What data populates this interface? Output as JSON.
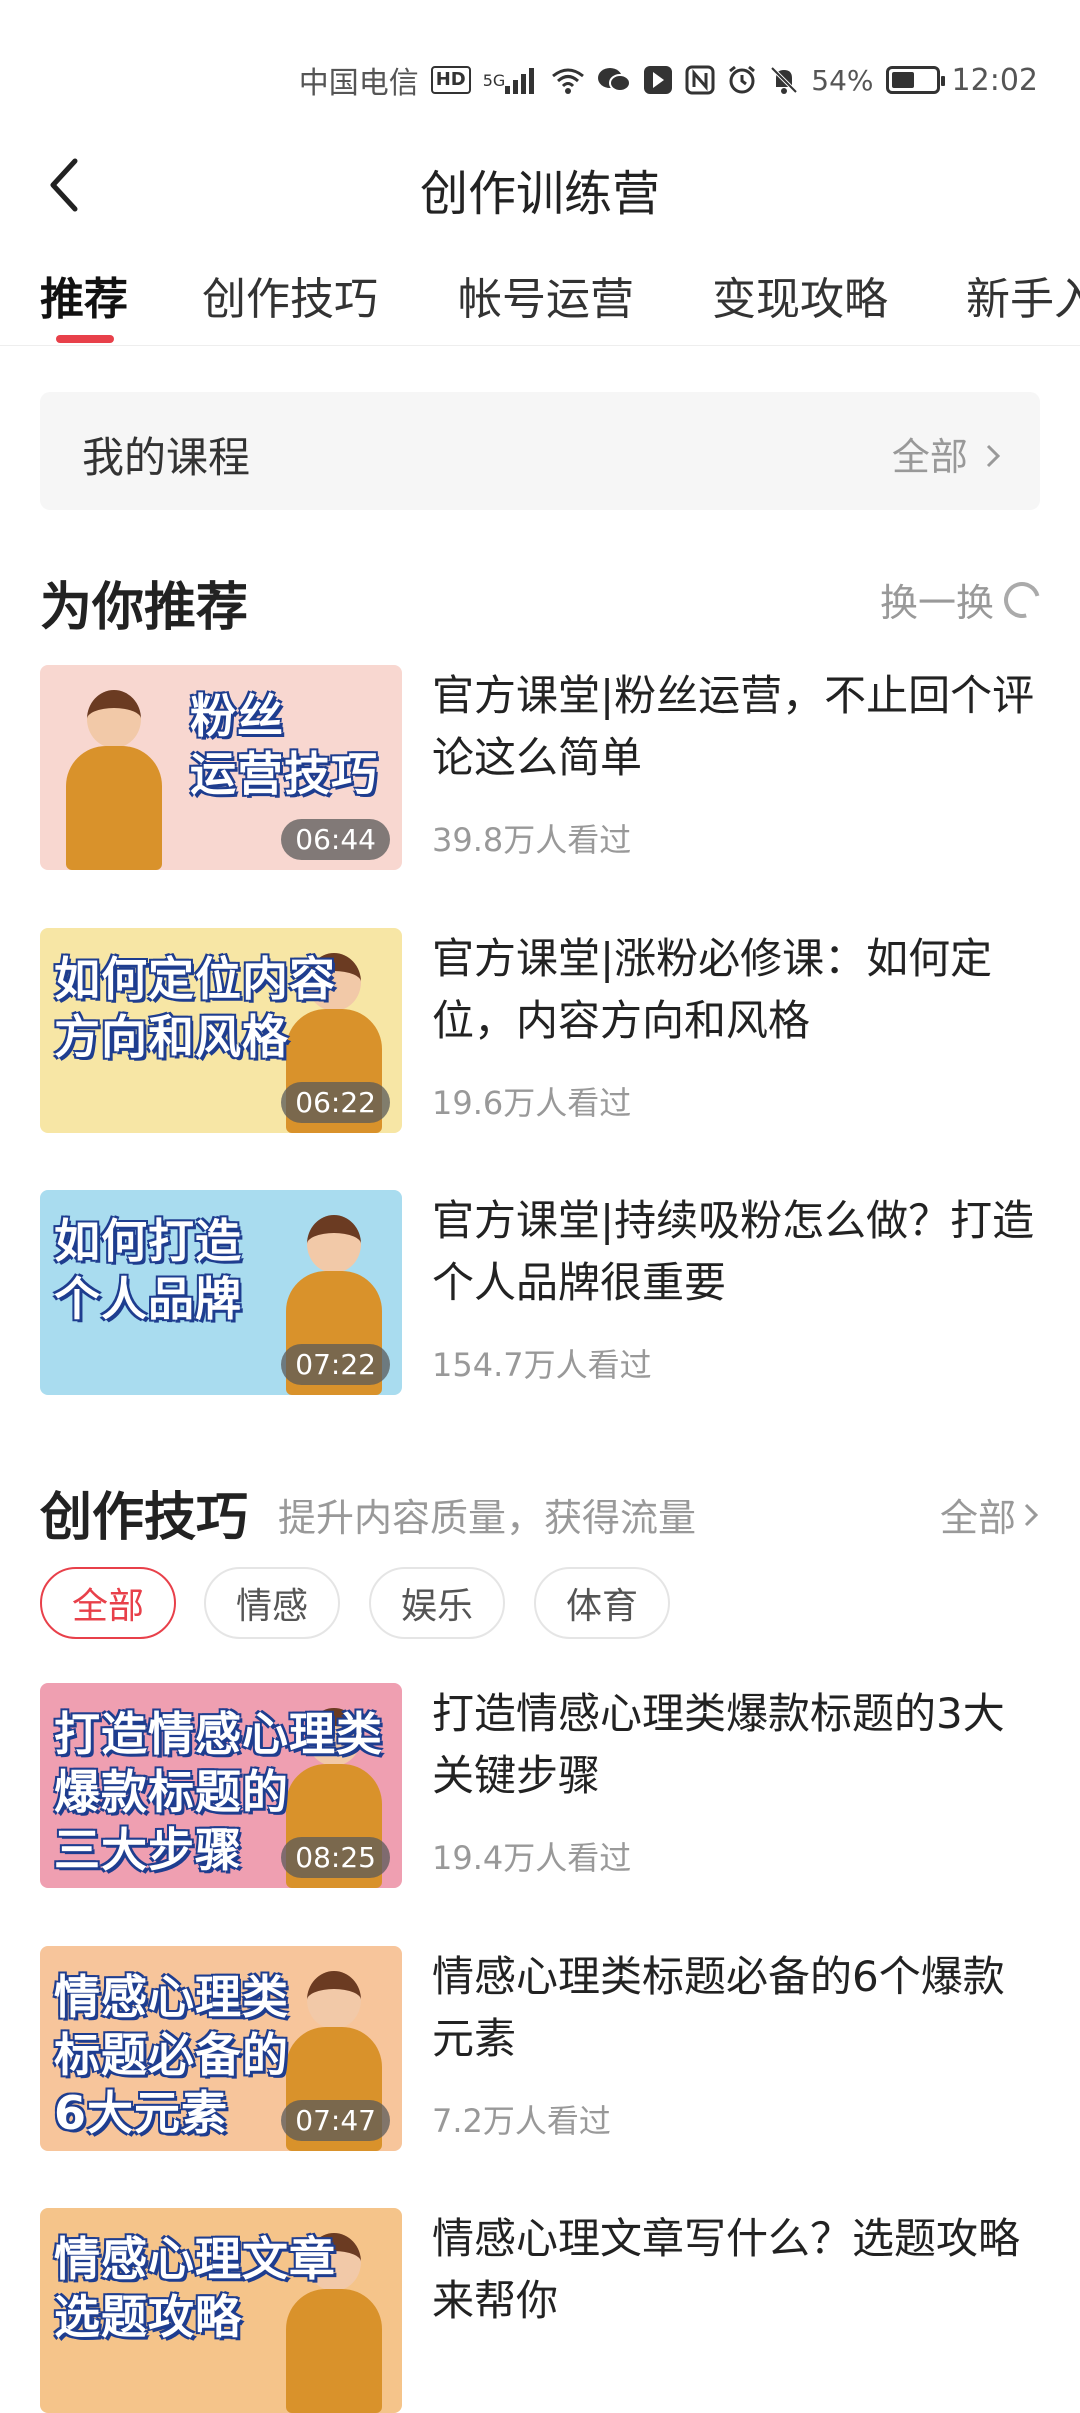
{
  "status_bar": {
    "carrier": "中国电信",
    "hd_badge": "HD",
    "network": "5G",
    "battery_text": "54%",
    "battery_level": 0.54,
    "time": "12:02"
  },
  "header": {
    "title": "创作训练营",
    "back_icon": "chevron-left-icon"
  },
  "tabs": [
    {
      "label": "推荐",
      "active": true
    },
    {
      "label": "创作技巧",
      "active": false
    },
    {
      "label": "帐号运营",
      "active": false
    },
    {
      "label": "变现攻略",
      "active": false
    },
    {
      "label": "新手入",
      "active": false
    }
  ],
  "my_courses": {
    "label": "我的课程",
    "more": "全部",
    "more_icon": "chevron-right-icon"
  },
  "recommend": {
    "title": "为你推荐",
    "refresh_label": "换一换",
    "refresh_icon": "refresh-icon",
    "items": [
      {
        "thumb_text": "粉丝\n运营技巧",
        "duration": "06:44",
        "title": "官方课堂|粉丝运营，不止回个评论这么简单",
        "views": "39.8万人看过",
        "bg": "#f8d7d0"
      },
      {
        "thumb_text": "如何定位内容\n方向和风格",
        "duration": "06:22",
        "title": "官方课堂|涨粉必修课：如何定位，内容方向和风格",
        "views": "19.6万人看过",
        "bg": "#f7e6a5"
      },
      {
        "thumb_text": "如何打造\n个人品牌",
        "duration": "07:22",
        "title": "官方课堂|持续吸粉怎么做？打造个人品牌很重要",
        "views": "154.7万人看过",
        "bg": "#a9dcef"
      }
    ]
  },
  "skills": {
    "title": "创作技巧",
    "subtitle": "提升内容质量，获得流量",
    "more": "全部",
    "chips": [
      {
        "label": "全部",
        "active": true
      },
      {
        "label": "情感",
        "active": false
      },
      {
        "label": "娱乐",
        "active": false
      },
      {
        "label": "体育",
        "active": false
      }
    ],
    "items": [
      {
        "thumb_text": "打造情感心理类\n爆款标题的\n三大步骤",
        "duration": "08:25",
        "title": "打造情感心理类爆款标题的3大关键步骤",
        "views": "19.4万人看过",
        "bg": "#ef9fb1"
      },
      {
        "thumb_text": "情感心理类\n标题必备的\n6大元素",
        "duration": "07:47",
        "title": "情感心理类标题必备的6个爆款元素",
        "views": "7.2万人看过",
        "bg": "#f7c59b"
      },
      {
        "thumb_text": "情感心理文章\n选题攻略",
        "duration": "",
        "title": "情感心理文章写什么？选题攻略来帮你",
        "views": "",
        "bg": "#f5c48a"
      }
    ]
  }
}
